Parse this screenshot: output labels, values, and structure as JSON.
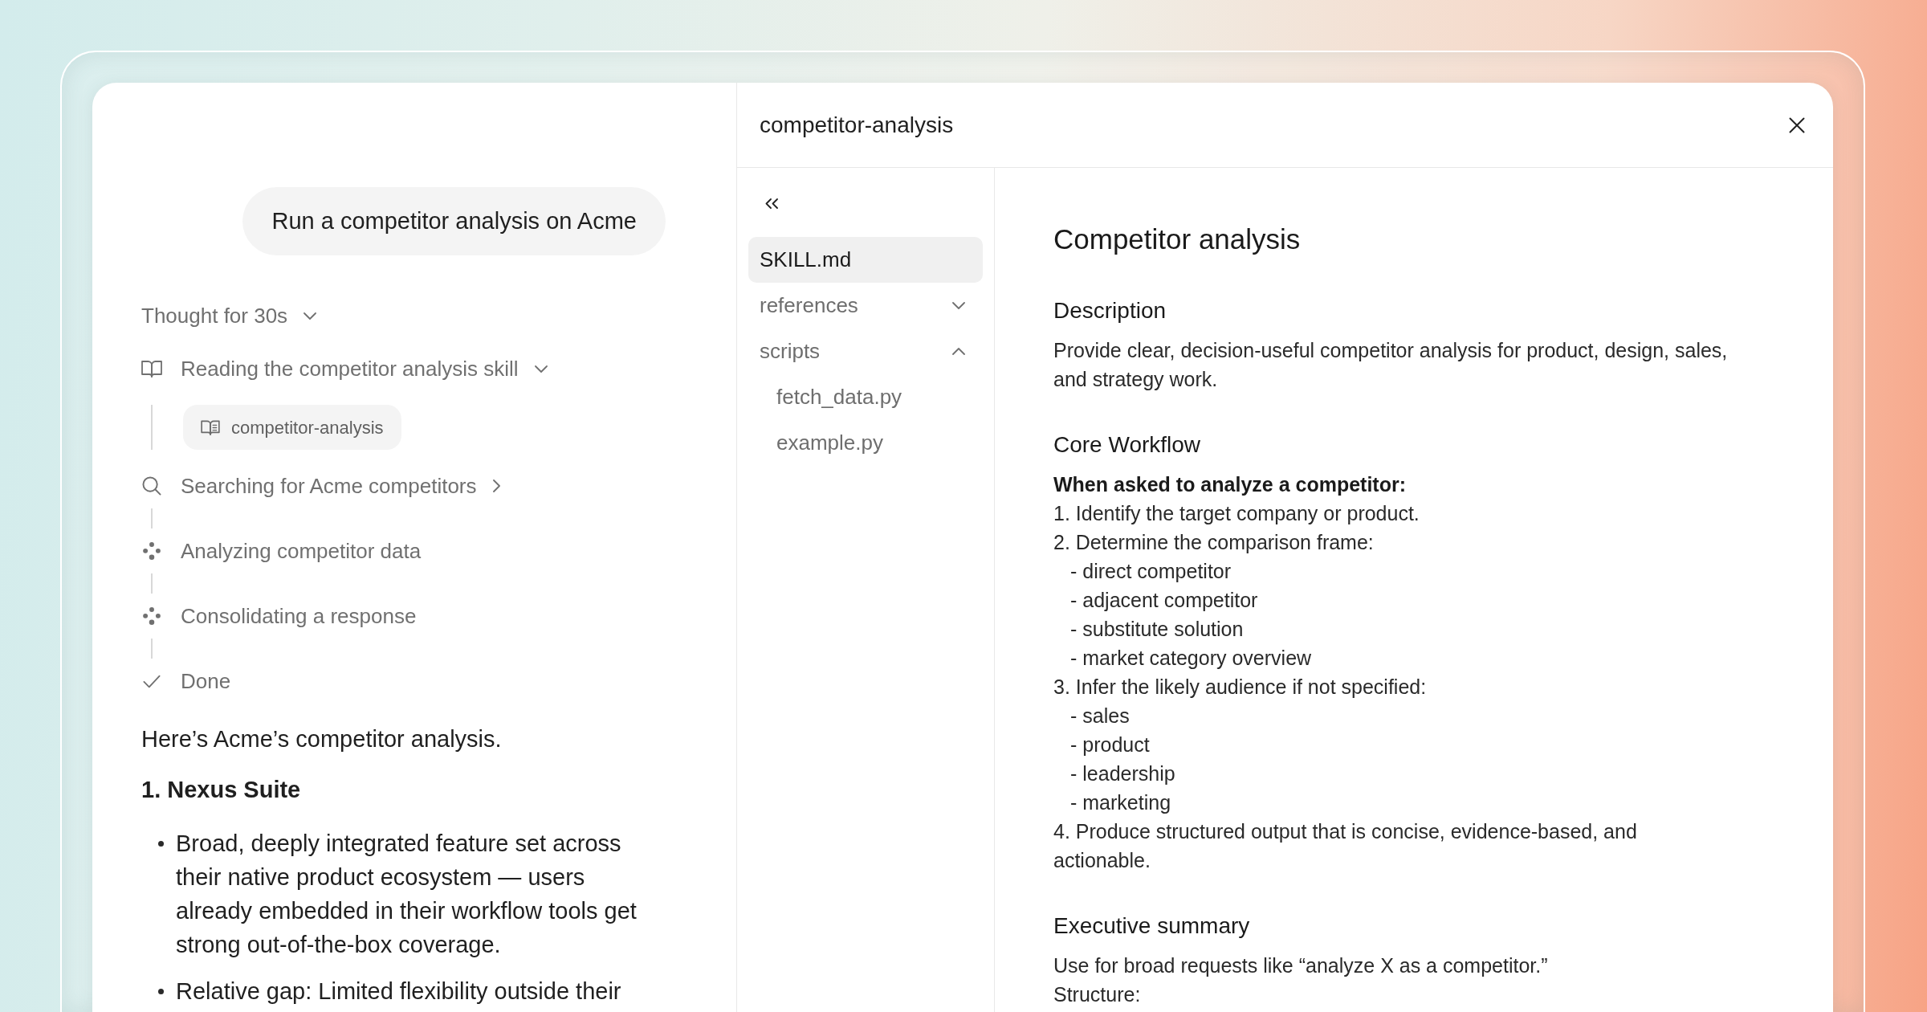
{
  "chat": {
    "user_message": "Run a competitor analysis on Acme",
    "thought": {
      "label": "Thought for 30s",
      "expanded": true
    },
    "steps": [
      {
        "kind": "read",
        "label": "Reading the competitor analysis skill",
        "expanded": true,
        "children": [
          {
            "label": "competitor-analysis"
          }
        ]
      },
      {
        "kind": "search",
        "label": "Searching for Acme competitors",
        "expanded": false
      },
      {
        "kind": "process",
        "label": "Analyzing competitor data"
      },
      {
        "kind": "process",
        "label": "Consolidating a response"
      },
      {
        "kind": "done",
        "label": "Done"
      }
    ],
    "answer": {
      "intro": "Here’s Acme’s competitor analysis.",
      "heading": "1. Nexus Suite",
      "bullets": [
        "Broad, deeply integrated feature set across their native product ecosystem — users already embedded in their workflow tools get strong out-of-the-box coverage.",
        "Relative gap: Limited flexibility outside their"
      ]
    }
  },
  "skill_panel": {
    "title": "competitor-analysis",
    "files": [
      {
        "label": "SKILL.md",
        "selected": true
      },
      {
        "label": "references",
        "selected": false,
        "expanded": false
      },
      {
        "label": "scripts",
        "selected": false,
        "expanded": true,
        "children": [
          {
            "label": "fetch_data.py",
            "selected": false
          },
          {
            "label": "example.py",
            "selected": false
          }
        ]
      }
    ],
    "document": {
      "title": "Competitor analysis",
      "sections": [
        {
          "heading": "Description",
          "lines": [
            {
              "kind": "paragraph",
              "text": "Provide clear, decision-useful competitor analysis for product, design, sales, and strategy work."
            }
          ]
        },
        {
          "heading": "Core Workflow",
          "lines": [
            {
              "kind": "lead",
              "text": "When asked to analyze a competitor:"
            },
            {
              "kind": "step",
              "text": "1. Identify the target company or product."
            },
            {
              "kind": "step",
              "text": "2. Determine the comparison frame:",
              "children": [
                "- direct competitor",
                "- adjacent competitor",
                "- substitute solution",
                "- market category overview"
              ]
            },
            {
              "kind": "step",
              "text": "3. Infer the likely audience if not specified:",
              "children": [
                "- sales",
                "- product",
                "- leadership",
                "- marketing"
              ]
            },
            {
              "kind": "step",
              "text": "4. Produce structured output that is concise, evidence-based, and actionable."
            }
          ]
        },
        {
          "heading": "Executive summary",
          "lines": [
            {
              "kind": "paragraph",
              "text": "Use for broad requests like “analyze X as a competitor.”"
            },
            {
              "kind": "paragraph",
              "text": "Structure:"
            }
          ]
        }
      ]
    }
  }
}
